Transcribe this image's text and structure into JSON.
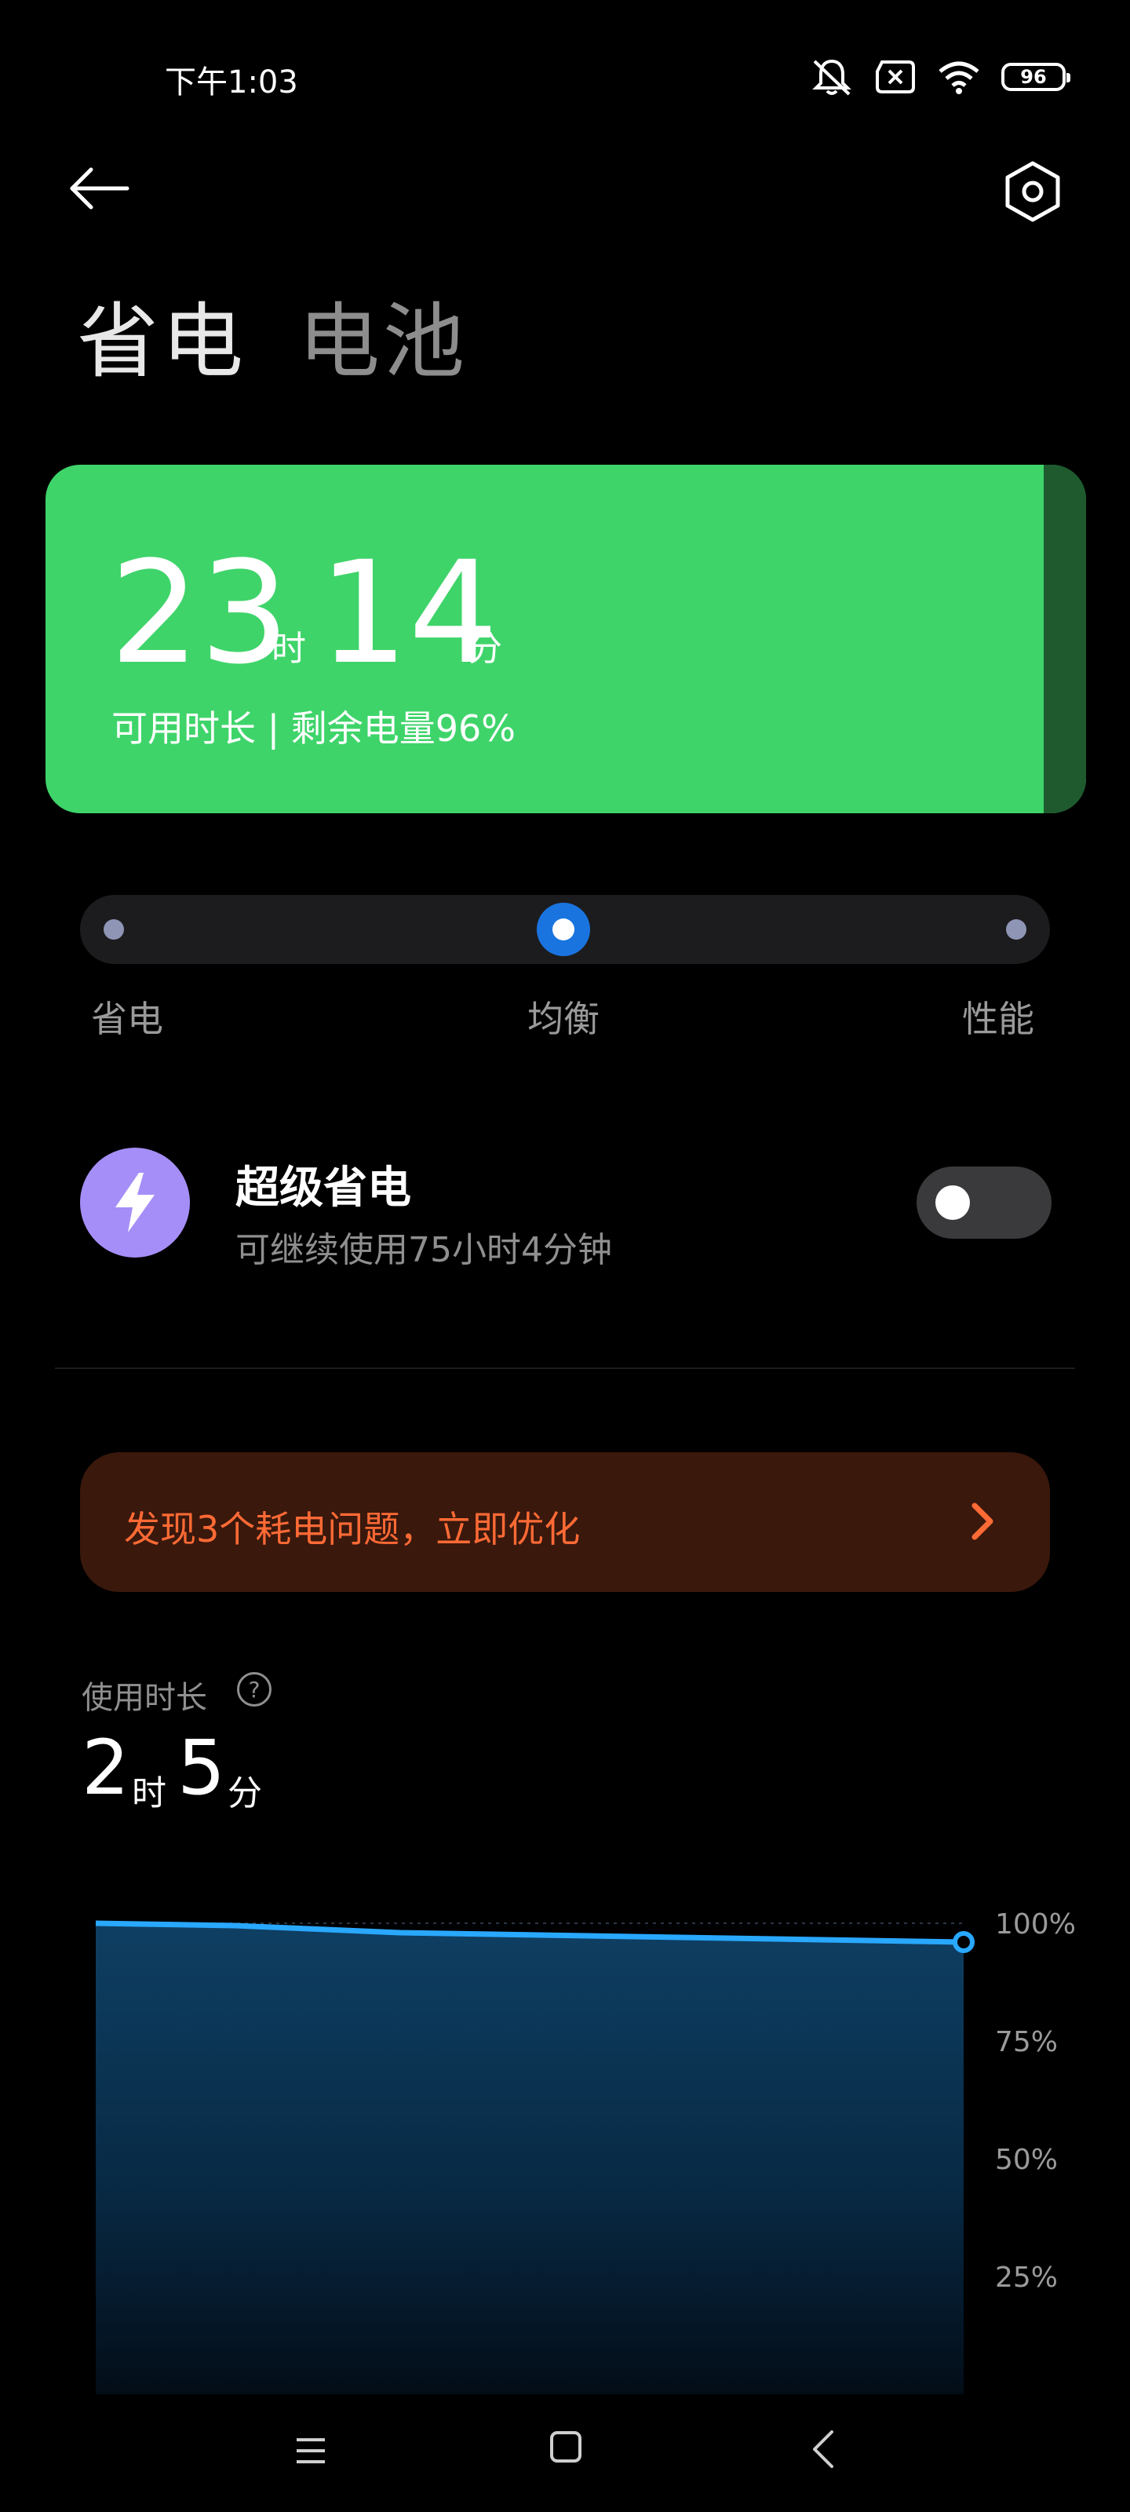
{
  "status_bar": {
    "time": "下午1:03",
    "battery_level": "96",
    "icons": [
      "mute-icon",
      "sim-off-icon",
      "wifi-icon",
      "battery-icon"
    ]
  },
  "header": {
    "tabs": [
      {
        "label": "省电",
        "active": true
      },
      {
        "label": "电池",
        "active": false
      }
    ],
    "back_icon": "arrow-left-icon",
    "settings_icon": "hexagon-settings-icon"
  },
  "battery_card": {
    "hours": "23",
    "hours_unit": "时",
    "minutes": "14",
    "minutes_unit": "分",
    "subtitle": "可用时长 | 剩余电量96%",
    "color": "#3fd46a"
  },
  "mode_selector": {
    "options": [
      "省电",
      "均衡",
      "性能"
    ],
    "selected": "均衡",
    "accent": "#1a74e0"
  },
  "super_saver": {
    "title": "超级省电",
    "subtitle": "可继续使用75小时4分钟",
    "enabled": false,
    "icon": "lightning-icon",
    "icon_color": "#a68ef8"
  },
  "optimize_banner": {
    "text": "发现3个耗电问题，立即优化",
    "color": "#ff6a35"
  },
  "usage": {
    "label": "使用时长",
    "hours": "2",
    "hours_unit": "时",
    "minutes": "5",
    "minutes_unit": "分"
  },
  "chart_data": {
    "type": "area",
    "y_ticks": [
      "100%",
      "75%",
      "50%",
      "25%"
    ],
    "ylim": [
      0,
      100
    ],
    "x": [
      0,
      0.16,
      0.35,
      1
    ],
    "values": [
      100,
      99.5,
      98,
      96
    ],
    "line_color": "#29a8ff",
    "grid": true
  },
  "nav_bar": {
    "icons": [
      "menu-icon",
      "home-icon",
      "back-icon"
    ]
  }
}
